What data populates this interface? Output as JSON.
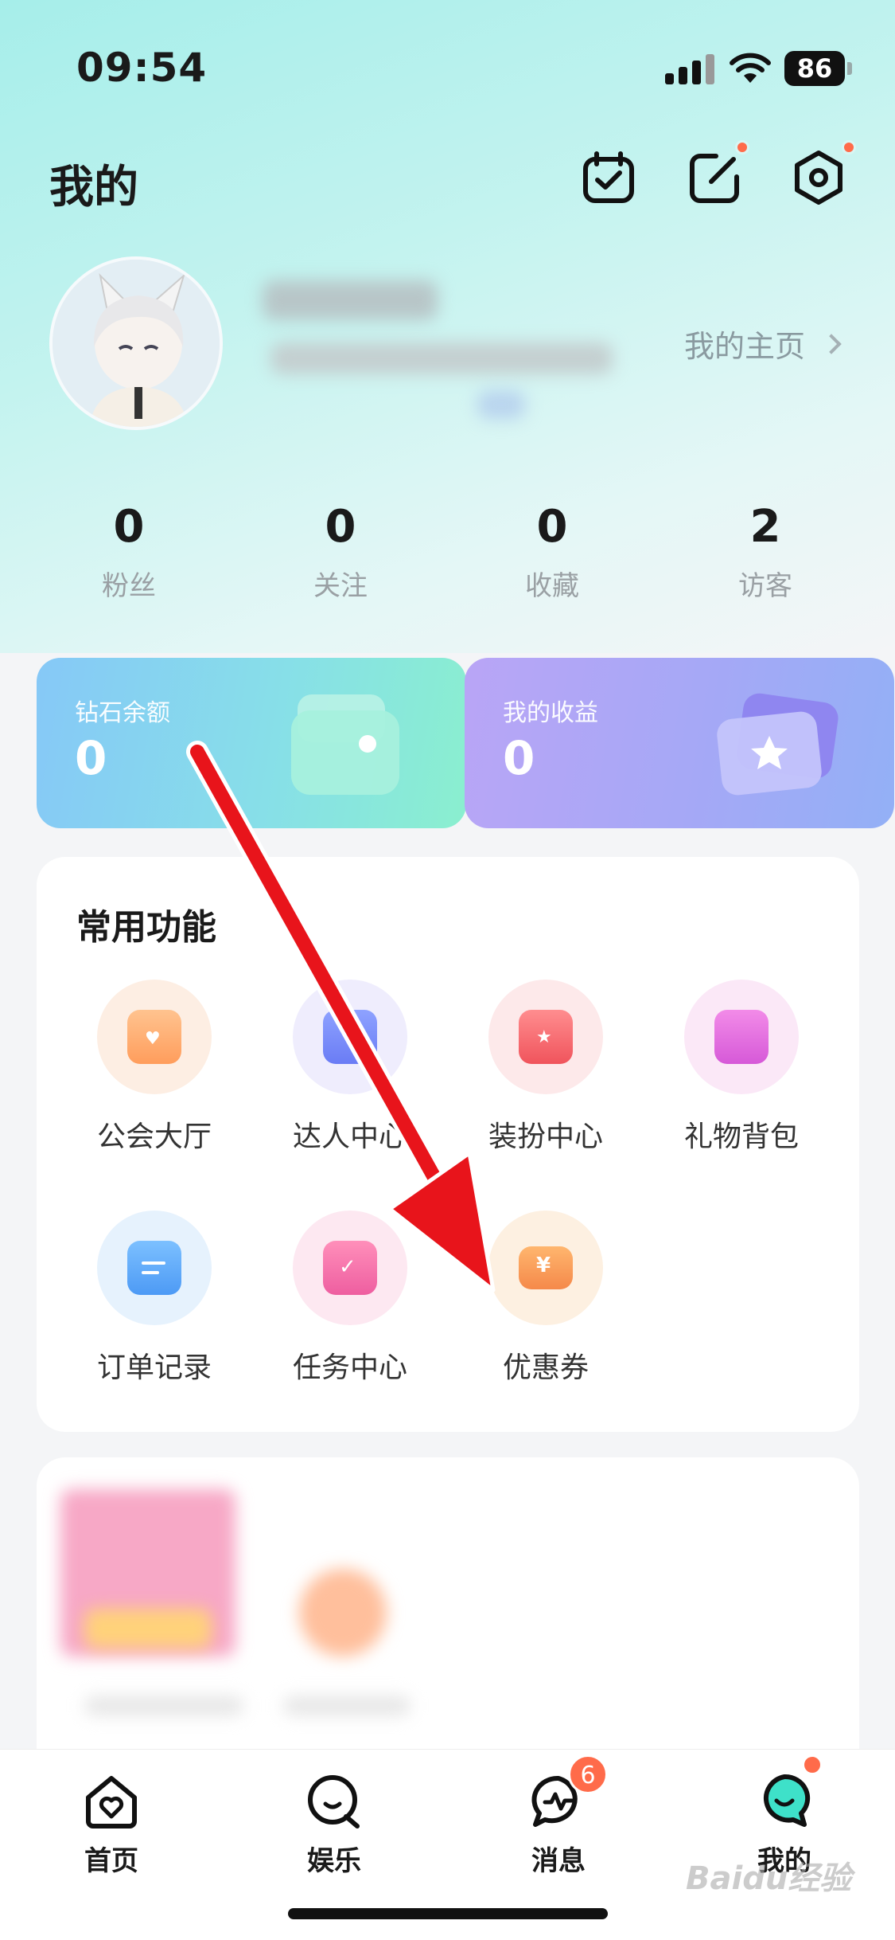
{
  "status_bar": {
    "time": "09:54",
    "battery": "86"
  },
  "header": {
    "title": "我的"
  },
  "profile": {
    "homepage_link": "我的主页"
  },
  "stats": [
    {
      "value": "0",
      "label": "粉丝"
    },
    {
      "value": "0",
      "label": "关注"
    },
    {
      "value": "0",
      "label": "收藏"
    },
    {
      "value": "2",
      "label": "访客"
    }
  ],
  "wallet_cards": {
    "diamonds": {
      "title": "钻石余额",
      "value": "0"
    },
    "earnings": {
      "title": "我的收益",
      "value": "0"
    }
  },
  "features": {
    "title": "常用功能",
    "items": [
      {
        "label": "公会大厅",
        "icon": "guild-hall-icon"
      },
      {
        "label": "达人中心",
        "icon": "talent-center-icon"
      },
      {
        "label": "装扮中心",
        "icon": "dress-up-icon"
      },
      {
        "label": "礼物背包",
        "icon": "gift-bag-icon"
      },
      {
        "label": "订单记录",
        "icon": "order-record-icon"
      },
      {
        "label": "任务中心",
        "icon": "task-center-icon"
      },
      {
        "label": "优惠券",
        "icon": "coupon-icon"
      }
    ]
  },
  "tabbar": {
    "items": [
      {
        "label": "首页",
        "icon": "home-icon"
      },
      {
        "label": "娱乐",
        "icon": "entertainment-icon"
      },
      {
        "label": "消息",
        "icon": "message-icon",
        "badge": "6"
      },
      {
        "label": "我的",
        "icon": "me-icon"
      }
    ]
  },
  "watermark": "Baidu经验",
  "colors": {
    "accent": "#ff6b4a",
    "arrow": "#e8141b"
  }
}
